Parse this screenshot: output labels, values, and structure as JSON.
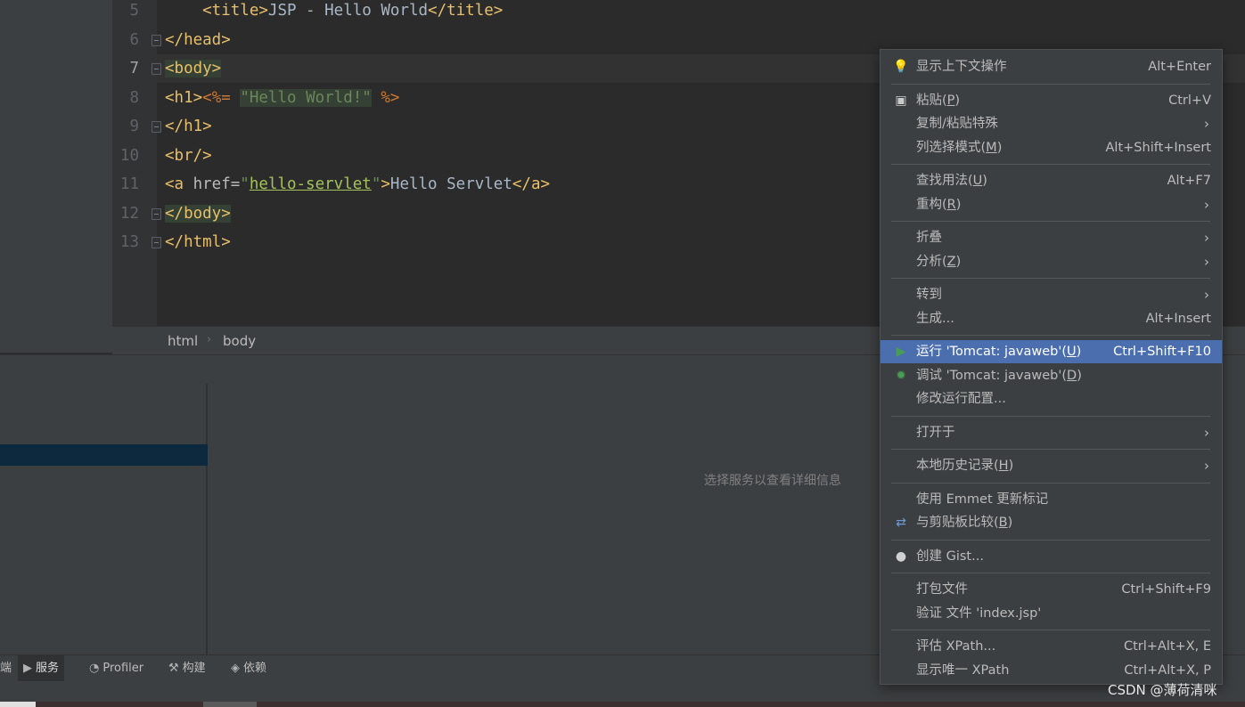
{
  "editor": {
    "lines": [
      {
        "num": "5",
        "parts": [
          [
            "tag",
            "    <title>"
          ],
          [
            "plain",
            "JSP - Hello World"
          ],
          [
            "tag",
            "</title>"
          ]
        ]
      },
      {
        "num": "6",
        "parts": [
          [
            "tag",
            "</head>"
          ]
        ]
      },
      {
        "num": "7",
        "parts": [
          [
            "taghl",
            "<body>"
          ]
        ]
      },
      {
        "num": "8",
        "parts": [
          [
            "tag",
            "<h1>"
          ],
          [
            "jsp",
            "<%= "
          ],
          [
            "jspstr",
            "\"Hello World!\""
          ],
          [
            "jsp",
            " %>"
          ]
        ]
      },
      {
        "num": "9",
        "parts": [
          [
            "tag",
            "</h1>"
          ]
        ]
      },
      {
        "num": "10",
        "parts": [
          [
            "tag",
            "<br/>"
          ]
        ]
      },
      {
        "num": "11",
        "parts": [
          [
            "tag",
            "<a "
          ],
          [
            "attr",
            "href="
          ],
          [
            "str",
            "\""
          ],
          [
            "link",
            "hello-servlet"
          ],
          [
            "str",
            "\""
          ],
          [
            "tag",
            ">"
          ],
          [
            "plain",
            "Hello Servlet"
          ],
          [
            "tag",
            "</a>"
          ]
        ]
      },
      {
        "num": "12",
        "parts": [
          [
            "taghl",
            "</body>"
          ]
        ]
      },
      {
        "num": "13",
        "parts": [
          [
            "tag",
            "</html>"
          ]
        ]
      }
    ]
  },
  "breadcrumb": {
    "items": [
      "html",
      "body"
    ],
    "separator": "›"
  },
  "services": {
    "placeholder": "选择服务以查看详细信息"
  },
  "bottom_toolbar": [
    {
      "label": "端",
      "icon": "terminal-icon"
    },
    {
      "label": "服务",
      "icon": "services-icon",
      "active": true
    },
    {
      "label": "Profiler",
      "icon": "profiler-icon"
    },
    {
      "label": "构建",
      "icon": "build-icon"
    },
    {
      "label": "依赖",
      "icon": "dependencies-icon"
    }
  ],
  "context_menu": {
    "items": [
      {
        "label": "显示上下文操作",
        "shortcut": "Alt+Enter",
        "icon": "bulb-icon"
      },
      {
        "sep": true
      },
      {
        "label": "粘贴(P)",
        "mn": "P",
        "shortcut": "Ctrl+V",
        "icon": "clipboard-icon"
      },
      {
        "label": "复制/粘贴特殊",
        "submenu": true
      },
      {
        "label": "列选择模式(M)",
        "mn": "M",
        "shortcut": "Alt+Shift+Insert"
      },
      {
        "sep": true
      },
      {
        "label": "查找用法(U)",
        "mn": "U",
        "shortcut": "Alt+F7"
      },
      {
        "label": "重构(R)",
        "mn": "R",
        "submenu": true
      },
      {
        "sep": true
      },
      {
        "label": "折叠",
        "submenu": true
      },
      {
        "label": "分析(Z)",
        "mn": "Z",
        "submenu": true
      },
      {
        "sep": true
      },
      {
        "label": "转到",
        "submenu": true
      },
      {
        "label": "生成...",
        "shortcut": "Alt+Insert"
      },
      {
        "sep": true
      },
      {
        "label": "运行 'Tomcat: javaweb'(U)",
        "mn": "U",
        "shortcut": "Ctrl+Shift+F10",
        "icon": "run-icon",
        "selected": true
      },
      {
        "label": "调试 'Tomcat: javaweb'(D)",
        "mn": "D",
        "icon": "debug-icon"
      },
      {
        "label": "修改运行配置..."
      },
      {
        "sep": true
      },
      {
        "label": "打开于",
        "submenu": true
      },
      {
        "sep": true
      },
      {
        "label": "本地历史记录(H)",
        "mn": "H",
        "submenu": true
      },
      {
        "sep": true
      },
      {
        "label": "使用 Emmet 更新标记"
      },
      {
        "label": "与剪贴板比较(B)",
        "mn": "B",
        "icon": "compare-icon"
      },
      {
        "sep": true
      },
      {
        "label": "创建 Gist...",
        "icon": "github-icon"
      },
      {
        "sep": true
      },
      {
        "label": "打包文件",
        "shortcut": "Ctrl+Shift+F9"
      },
      {
        "label": "验证 文件 'index.jsp'"
      },
      {
        "sep": true
      },
      {
        "label": "评估 XPath...",
        "shortcut": "Ctrl+Alt+X, E"
      },
      {
        "label": "显示唯一 XPath",
        "shortcut": "Ctrl+Alt+X, P"
      }
    ]
  },
  "watermark": "CSDN @薄荷清咪",
  "colors": {
    "selection": "#4b6eaf",
    "menu_bg": "#3c3f41",
    "editor_bg": "#2b2b2b",
    "tag": "#e8bf6a",
    "string": "#6a8759",
    "jsp": "#cc7832"
  }
}
